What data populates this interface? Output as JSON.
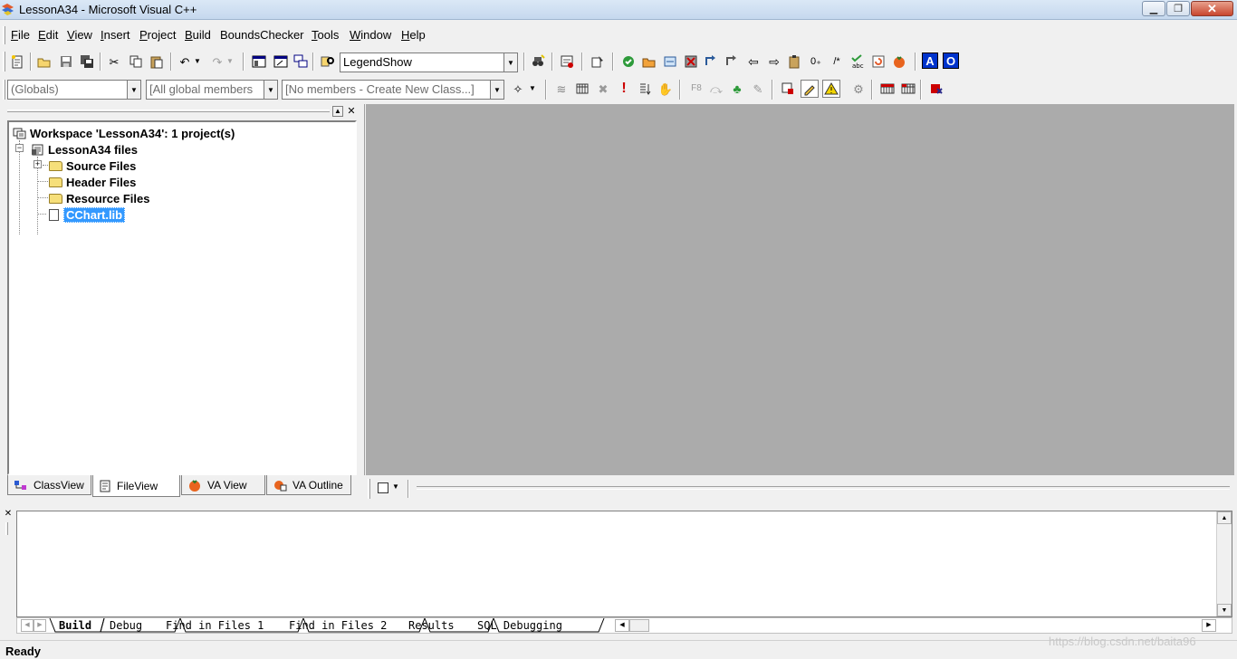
{
  "window": {
    "title": "LessonA34 - Microsoft Visual C++",
    "min_glyph": "▁",
    "max_glyph": "❐",
    "close_glyph": "✕"
  },
  "menu": [
    {
      "label": "File",
      "accel": "F",
      "rest": "ile"
    },
    {
      "label": "Edit",
      "accel": "E",
      "rest": "dit"
    },
    {
      "label": "View",
      "accel": "V",
      "rest": "iew"
    },
    {
      "label": "Insert",
      "accel": "I",
      "rest": "nsert"
    },
    {
      "label": "Project",
      "accel": "P",
      "rest": "roject"
    },
    {
      "label": "Build",
      "accel": "B",
      "rest": "uild"
    },
    {
      "label": "BoundsChecker",
      "accel": "",
      "rest": "BoundsChecker"
    },
    {
      "label": "Tools",
      "accel": "T",
      "rest": "ools"
    },
    {
      "label": "Window",
      "accel": "W",
      "rest": "indow"
    },
    {
      "label": "Help",
      "accel": "H",
      "rest": "elp"
    }
  ],
  "toolbar": {
    "find_combo_value": "LegendShow",
    "font_a_label": "A",
    "font_o_label": "O"
  },
  "wizardbar": {
    "class_combo": "(Globals)",
    "filter_combo": "[All global members",
    "members_combo": "[No members - Create New Class...]",
    "f8_label": "F8"
  },
  "workspace": {
    "root_label": "Workspace 'LessonA34': 1 project(s)",
    "project_label": "LessonA34 files",
    "items": [
      {
        "label": "Source Files",
        "type": "folder",
        "expandable": true
      },
      {
        "label": "Header Files",
        "type": "folder",
        "expandable": false
      },
      {
        "label": "Resource Files",
        "type": "folder",
        "expandable": false
      },
      {
        "label": "CChart.lib",
        "type": "file",
        "selected": true
      }
    ],
    "tabs": [
      {
        "label": "ClassView",
        "active": false
      },
      {
        "label": "FileView",
        "active": true
      },
      {
        "label": "VA View",
        "active": false
      },
      {
        "label": "VA Outline",
        "active": false
      }
    ]
  },
  "output": {
    "tabs": [
      {
        "label": "Build",
        "active": true
      },
      {
        "label": "Debug",
        "active": false
      },
      {
        "label": "Find in Files 1",
        "active": false
      },
      {
        "label": "Find in Files 2",
        "active": false
      },
      {
        "label": "Results",
        "active": false
      },
      {
        "label": "SQL Debugging",
        "active": false
      }
    ]
  },
  "status": {
    "text": "Ready"
  },
  "watermark": "https://blog.csdn.net/baita96",
  "colors": {
    "mdi_background": "#ababab",
    "selection": "#3399ff",
    "font_icon_bg": "#0033cc"
  }
}
